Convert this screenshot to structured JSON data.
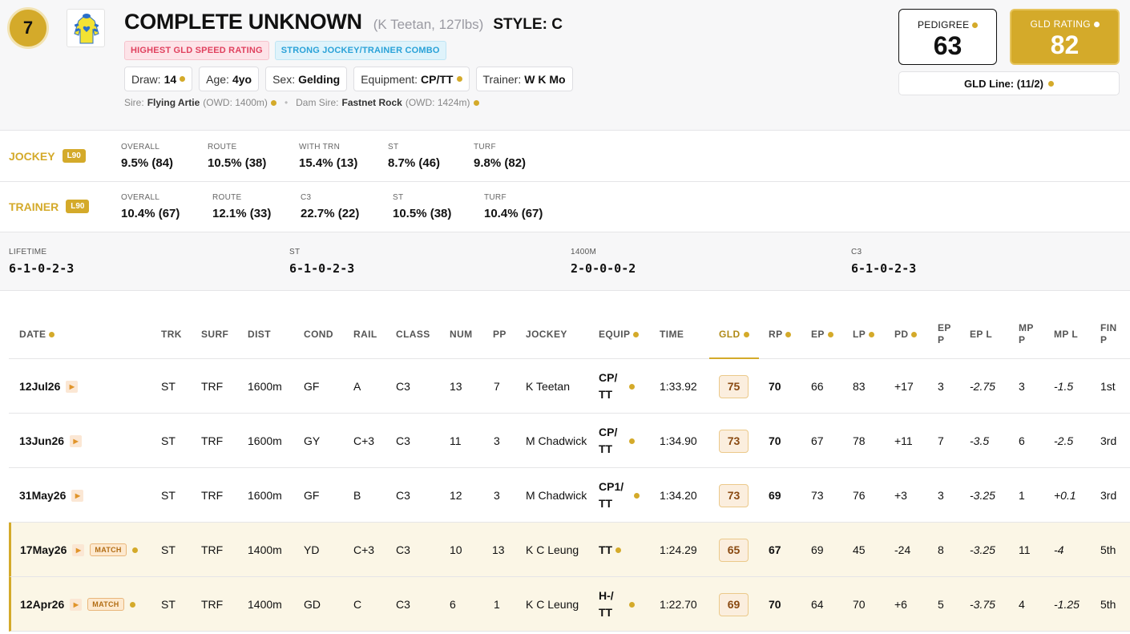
{
  "horse": {
    "number": "7",
    "name": "COMPLETE UNKNOWN",
    "jockey_weight": "(K Teetan, 127lbs)",
    "style": "STYLE: C",
    "badges": [
      "HIGHEST GLD SPEED RATING",
      "STRONG JOCKEY/TRAINER COMBO"
    ],
    "chips": [
      {
        "label": "Draw:",
        "value": "14",
        "dot": true
      },
      {
        "label": "Age:",
        "value": "4yo",
        "dot": false
      },
      {
        "label": "Sex:",
        "value": "Gelding",
        "dot": false
      },
      {
        "label": "Equipment:",
        "value": "CP/TT",
        "dot": true
      },
      {
        "label": "Trainer:",
        "value": "W K Mo",
        "dot": false
      }
    ],
    "sire_label": "Sire:",
    "sire": "Flying Artie",
    "sire_owd": "(OWD: 1400m)",
    "dam_sire_label": "Dam Sire:",
    "dam_sire": "Fastnet Rock",
    "dam_sire_owd": "(OWD: 1424m)"
  },
  "ratings": {
    "pedigree_label": "PEDIGREE",
    "pedigree": "63",
    "gld_label": "GLD RATING",
    "gld": "82",
    "gld_line": "GLD Line: (11/2)"
  },
  "jockey_stats": {
    "label": "JOCKEY",
    "period": "L90",
    "items": [
      {
        "label": "OVERALL",
        "value": "9.5% (84)"
      },
      {
        "label": "ROUTE",
        "value": "10.5% (38)"
      },
      {
        "label": "WITH TRN",
        "value": "15.4% (13)"
      },
      {
        "label": "ST",
        "value": "8.7% (46)"
      },
      {
        "label": "TURF",
        "value": "9.8% (82)"
      }
    ]
  },
  "trainer_stats": {
    "label": "TRAINER",
    "period": "L90",
    "items": [
      {
        "label": "OVERALL",
        "value": "10.4% (67)"
      },
      {
        "label": "ROUTE",
        "value": "12.1% (33)"
      },
      {
        "label": "C3",
        "value": "22.7% (22)"
      },
      {
        "label": "ST",
        "value": "10.5% (38)"
      },
      {
        "label": "TURF",
        "value": "10.4% (67)"
      }
    ]
  },
  "summary": [
    {
      "label": "LIFETIME",
      "value": "6-1-0-2-3"
    },
    {
      "label": "ST",
      "value": "6-1-0-2-3"
    },
    {
      "label": "1400M",
      "value": "2-0-0-0-2"
    },
    {
      "label": "C3",
      "value": "6-1-0-2-3"
    }
  ],
  "table": {
    "headers": {
      "date": "DATE",
      "trk": "TRK",
      "surf": "SURF",
      "dist": "DIST",
      "cond": "COND",
      "rail": "RAIL",
      "class": "CLASS",
      "num": "NUM",
      "pp": "PP",
      "jockey": "JOCKEY",
      "equip": "EQUIP",
      "time": "TIME",
      "gld": "GLD",
      "rp": "RP",
      "ep": "EP",
      "lp": "LP",
      "pd": "PD",
      "epp_1": "EP",
      "epp_2": "P",
      "epl": "EP L",
      "mpp_1": "MP",
      "mpp_2": "P",
      "mpl": "MP L",
      "fin_1": "FIN",
      "fin_2": "P"
    },
    "match_label": "MATCH",
    "rows": [
      {
        "date": "12Jul26",
        "match": false,
        "trk": "ST",
        "surf": "TRF",
        "dist": "1600m",
        "cond": "GF",
        "rail": "A",
        "class": "C3",
        "num": "13",
        "pp": "7",
        "jockey": "K Teetan",
        "equip": "CP/ TT",
        "time": "1:33.92",
        "gld": "75",
        "rp": "70",
        "ep": "66",
        "lp": "83",
        "pd": "+17",
        "epp": "3",
        "epl": "-2.75",
        "mpp": "3",
        "mpl": "-1.5",
        "fin": "1st"
      },
      {
        "date": "13Jun26",
        "match": false,
        "trk": "ST",
        "surf": "TRF",
        "dist": "1600m",
        "cond": "GY",
        "rail": "C+3",
        "class": "C3",
        "num": "11",
        "pp": "3",
        "jockey": "M Chadwick",
        "equip": "CP/ TT",
        "time": "1:34.90",
        "gld": "73",
        "rp": "70",
        "ep": "67",
        "lp": "78",
        "pd": "+11",
        "epp": "7",
        "epl": "-3.5",
        "mpp": "6",
        "mpl": "-2.5",
        "fin": "3rd"
      },
      {
        "date": "31May26",
        "match": false,
        "trk": "ST",
        "surf": "TRF",
        "dist": "1600m",
        "cond": "GF",
        "rail": "B",
        "class": "C3",
        "num": "12",
        "pp": "3",
        "jockey": "M Chadwick",
        "equip": "CP1/ TT",
        "time": "1:34.20",
        "gld": "73",
        "rp": "69",
        "ep": "73",
        "lp": "76",
        "pd": "+3",
        "epp": "3",
        "epl": "-3.25",
        "mpp": "1",
        "mpl": "+0.1",
        "fin": "3rd"
      },
      {
        "date": "17May26",
        "match": true,
        "trk": "ST",
        "surf": "TRF",
        "dist": "1400m",
        "cond": "YD",
        "rail": "C+3",
        "class": "C3",
        "num": "10",
        "pp": "13",
        "jockey": "K C Leung",
        "equip": "TT",
        "time": "1:24.29",
        "gld": "65",
        "rp": "67",
        "ep": "69",
        "lp": "45",
        "pd": "-24",
        "epp": "8",
        "epl": "-3.25",
        "mpp": "11",
        "mpl": "-4",
        "fin": "5th"
      },
      {
        "date": "12Apr26",
        "match": true,
        "trk": "ST",
        "surf": "TRF",
        "dist": "1400m",
        "cond": "GD",
        "rail": "C",
        "class": "C3",
        "num": "6",
        "pp": "1",
        "jockey": "K C Leung",
        "equip": "H-/ TT",
        "time": "1:22.70",
        "gld": "69",
        "rp": "70",
        "ep": "64",
        "lp": "70",
        "pd": "+6",
        "epp": "5",
        "epl": "-3.75",
        "mpp": "4",
        "mpl": "-1.25",
        "fin": "5th"
      }
    ]
  },
  "colors": {
    "gold": "#d4aa2a",
    "badge_red": "#e0425f",
    "badge_blue": "#2aa2d8"
  }
}
